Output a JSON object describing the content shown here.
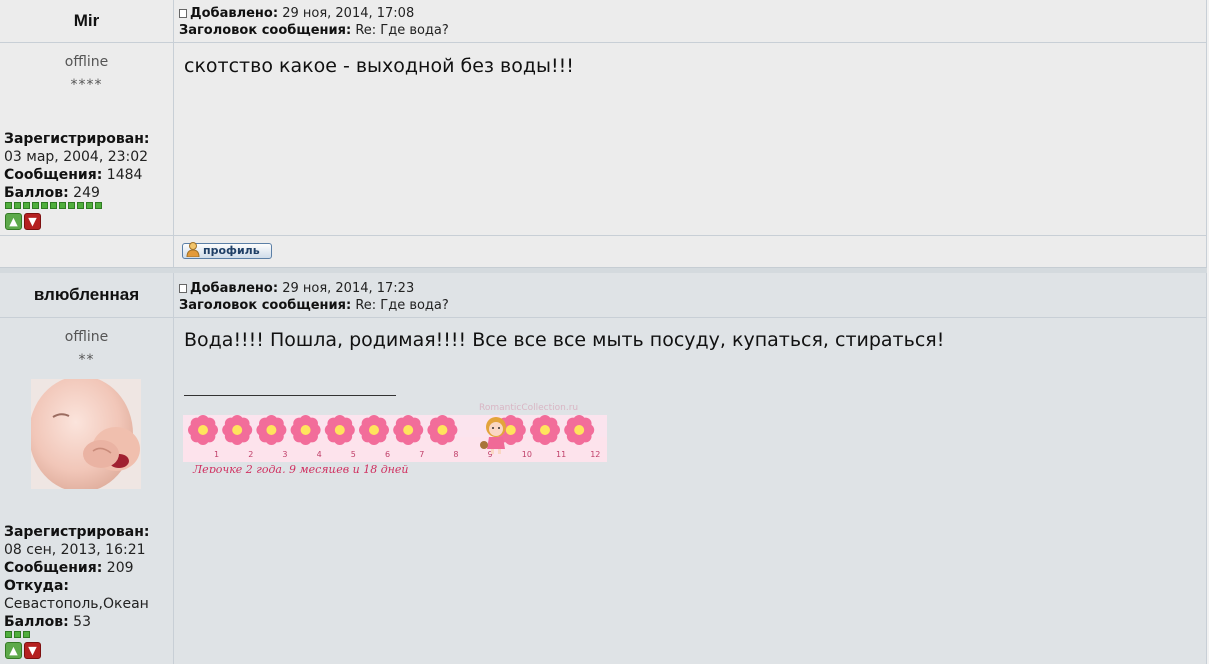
{
  "labels": {
    "added": "Добавлено:",
    "subject": "Заголовок сообщения:",
    "registered": "Зарегистрирован:",
    "messages": "Сообщения:",
    "from": "Откуда:",
    "points": "Баллов:",
    "profile_button": "профиль"
  },
  "posts": [
    {
      "author": "Mir",
      "status": "offline",
      "stars": "****",
      "added": "29 ноя, 2014, 17:08",
      "subject": "Re: Где вода?",
      "registered": "03 мар, 2004, 23:02",
      "messages": "1484",
      "points": "249",
      "rank_squares": 11,
      "text": "скотство какое - выходной без воды!!!"
    },
    {
      "author": "влюбленная",
      "status": "offline",
      "stars": "**",
      "added": "29 ноя, 2014, 17:23",
      "subject": "Re: Где вода?",
      "registered": "08 сен, 2013, 16:21",
      "messages": "209",
      "from": "Севастополь,Океан",
      "points": "53",
      "rank_squares": 3,
      "text": "Вода!!!! Пошла, родимая!!!! Все все все мыть посуду, купаться, стираться!",
      "signature": {
        "watermark": "RomanticCollection.ru",
        "caption": "Лерочке 2 года, 9 месяцев и 18 дней",
        "numbers": [
          "1",
          "2",
          "3",
          "4",
          "5",
          "6",
          "7",
          "8",
          "9",
          "10",
          "11",
          "12"
        ]
      }
    }
  ],
  "colors": {
    "post_a_bg": "#ececec",
    "post_b_bg": "#dfe3e6",
    "rank_green": "#4fae3c",
    "vote_up": "#5da94a",
    "vote_down": "#b52020",
    "flower_pink": "#f26d9a"
  }
}
